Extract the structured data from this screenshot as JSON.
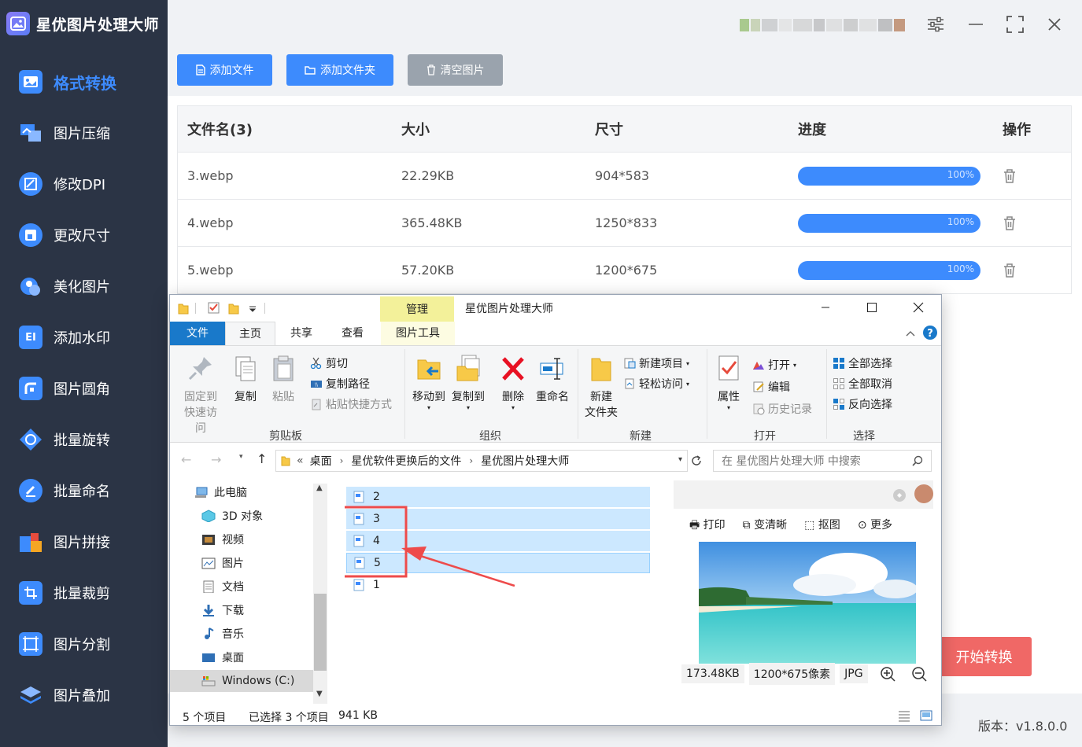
{
  "app": {
    "title": "星优图片处理大师",
    "version_label": "版本：v1.8.0.0",
    "start_button": "开始转换"
  },
  "sidebar": {
    "items": [
      {
        "label": "格式转换",
        "active": true,
        "icon": "format-convert-icon"
      },
      {
        "label": "图片压缩",
        "icon": "compress-icon"
      },
      {
        "label": "修改DPI",
        "icon": "dpi-icon"
      },
      {
        "label": "更改尺寸",
        "icon": "resize-icon"
      },
      {
        "label": "美化图片",
        "icon": "beautify-icon"
      },
      {
        "label": "添加水印",
        "icon": "watermark-icon"
      },
      {
        "label": "图片圆角",
        "icon": "rounded-corner-icon"
      },
      {
        "label": "批量旋转",
        "icon": "rotate-icon"
      },
      {
        "label": "批量命名",
        "icon": "rename-icon"
      },
      {
        "label": "图片拼接",
        "icon": "stitch-icon"
      },
      {
        "label": "批量裁剪",
        "icon": "crop-icon"
      },
      {
        "label": "图片分割",
        "icon": "split-icon"
      },
      {
        "label": "图片叠加",
        "icon": "overlay-icon"
      }
    ]
  },
  "toolbar": {
    "add_file": "添加文件",
    "add_folder": "添加文件夹",
    "clear_images": "清空图片"
  },
  "table": {
    "headers": {
      "name": "文件名(3)",
      "size": "大小",
      "dimension": "尺寸",
      "progress": "进度",
      "action": "操作"
    },
    "rows": [
      {
        "name": "3.webp",
        "size": "22.29KB",
        "dimension": "904*583",
        "progress": "100%",
        "progress_value": 1.0
      },
      {
        "name": "4.webp",
        "size": "365.48KB",
        "dimension": "1250*833",
        "progress": "100%",
        "progress_value": 1.0
      },
      {
        "name": "5.webp",
        "size": "57.20KB",
        "dimension": "1200*675",
        "progress": "100%",
        "progress_value": 1.0
      }
    ]
  },
  "explorer": {
    "manage_tab": "管理",
    "title": "星优图片处理大师",
    "tabs": {
      "file": "文件",
      "home": "主页",
      "share": "共享",
      "view": "查看",
      "picture_tools": "图片工具"
    },
    "ribbon": {
      "pin": "固定到",
      "pin2": "快速访问",
      "copy": "复制",
      "paste": "粘贴",
      "cut": "剪切",
      "copy_path": "复制路径",
      "paste_shortcut": "粘贴快捷方式",
      "clipboard_group": "剪贴板",
      "move_to": "移动到",
      "copy_to": "复制到",
      "delete": "删除",
      "rename": "重命名",
      "organize_group": "组织",
      "new_folder": "新建",
      "new_folder2": "文件夹",
      "new_item": "新建项目",
      "easy_access": "轻松访问",
      "new_group": "新建",
      "properties": "属性",
      "open": "打开",
      "edit": "编辑",
      "history": "历史记录",
      "open_group": "打开",
      "select_all": "全部选择",
      "select_none": "全部取消",
      "invert_selection": "反向选择",
      "select_group": "选择"
    },
    "address": {
      "prefix": "«",
      "crumbs": [
        "桌面",
        "星优软件更换后的文件",
        "星优图片处理大师"
      ]
    },
    "search_placeholder": "在 星优图片处理大师 中搜索",
    "nav_pane": [
      {
        "label": "此电脑",
        "icon": "this-pc-icon"
      },
      {
        "label": "3D 对象",
        "icon": "3d-objects-icon"
      },
      {
        "label": "视频",
        "icon": "video-folder-icon"
      },
      {
        "label": "图片",
        "icon": "pictures-folder-icon"
      },
      {
        "label": "文档",
        "icon": "documents-folder-icon"
      },
      {
        "label": "下载",
        "icon": "downloads-folder-icon"
      },
      {
        "label": "音乐",
        "icon": "music-folder-icon"
      },
      {
        "label": "桌面",
        "icon": "desktop-folder-icon"
      },
      {
        "label": "Windows (C:)",
        "icon": "drive-icon"
      }
    ],
    "files": [
      {
        "name": "2",
        "selected": true
      },
      {
        "name": "3",
        "selected": true
      },
      {
        "name": "4",
        "selected": true
      },
      {
        "name": "5",
        "selected": true
      },
      {
        "name": "1",
        "selected": false
      }
    ],
    "preview": {
      "print": "打印",
      "enhance": "变清晰",
      "cutout": "抠图",
      "more": "更多",
      "file_size": "173.48KB",
      "pixels": "1200*675像素",
      "format": "JPG"
    },
    "status": {
      "count": "5 个项目",
      "selected": "已选择 3 个项目",
      "size": "941 KB"
    }
  }
}
